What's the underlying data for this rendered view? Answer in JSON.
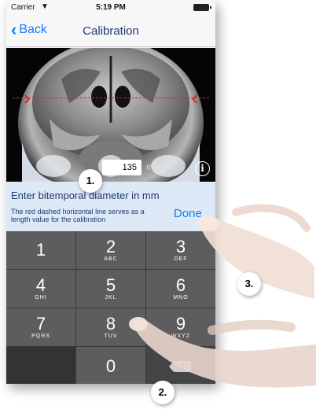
{
  "status_bar": {
    "carrier": "Carrier",
    "time": "5:19 PM"
  },
  "nav": {
    "back_label": "Back",
    "title": "Calibration"
  },
  "measurement": {
    "value": "135",
    "unit": "mm"
  },
  "panel": {
    "heading": "Enter bitemporal diameter in mm",
    "note": "The red dashed horizontal line serves as a length value for the calibration",
    "done_label": "Done"
  },
  "keypad": {
    "keys": [
      {
        "digit": "1",
        "letters": ""
      },
      {
        "digit": "2",
        "letters": "ABC"
      },
      {
        "digit": "3",
        "letters": "DEF"
      },
      {
        "digit": "4",
        "letters": "GHI"
      },
      {
        "digit": "5",
        "letters": "JKL"
      },
      {
        "digit": "6",
        "letters": "MNO"
      },
      {
        "digit": "7",
        "letters": "PQRS"
      },
      {
        "digit": "8",
        "letters": "TUV"
      },
      {
        "digit": "9",
        "letters": "WXYZ"
      },
      {
        "digit": "0",
        "letters": ""
      }
    ]
  },
  "callouts": {
    "one": "1.",
    "two": "2.",
    "three": "3."
  },
  "colors": {
    "accent": "#1a7cf5",
    "calibration_line": "#e0202a",
    "panel_background": "#dde9f7",
    "keypad_key": "#5d5d60"
  }
}
